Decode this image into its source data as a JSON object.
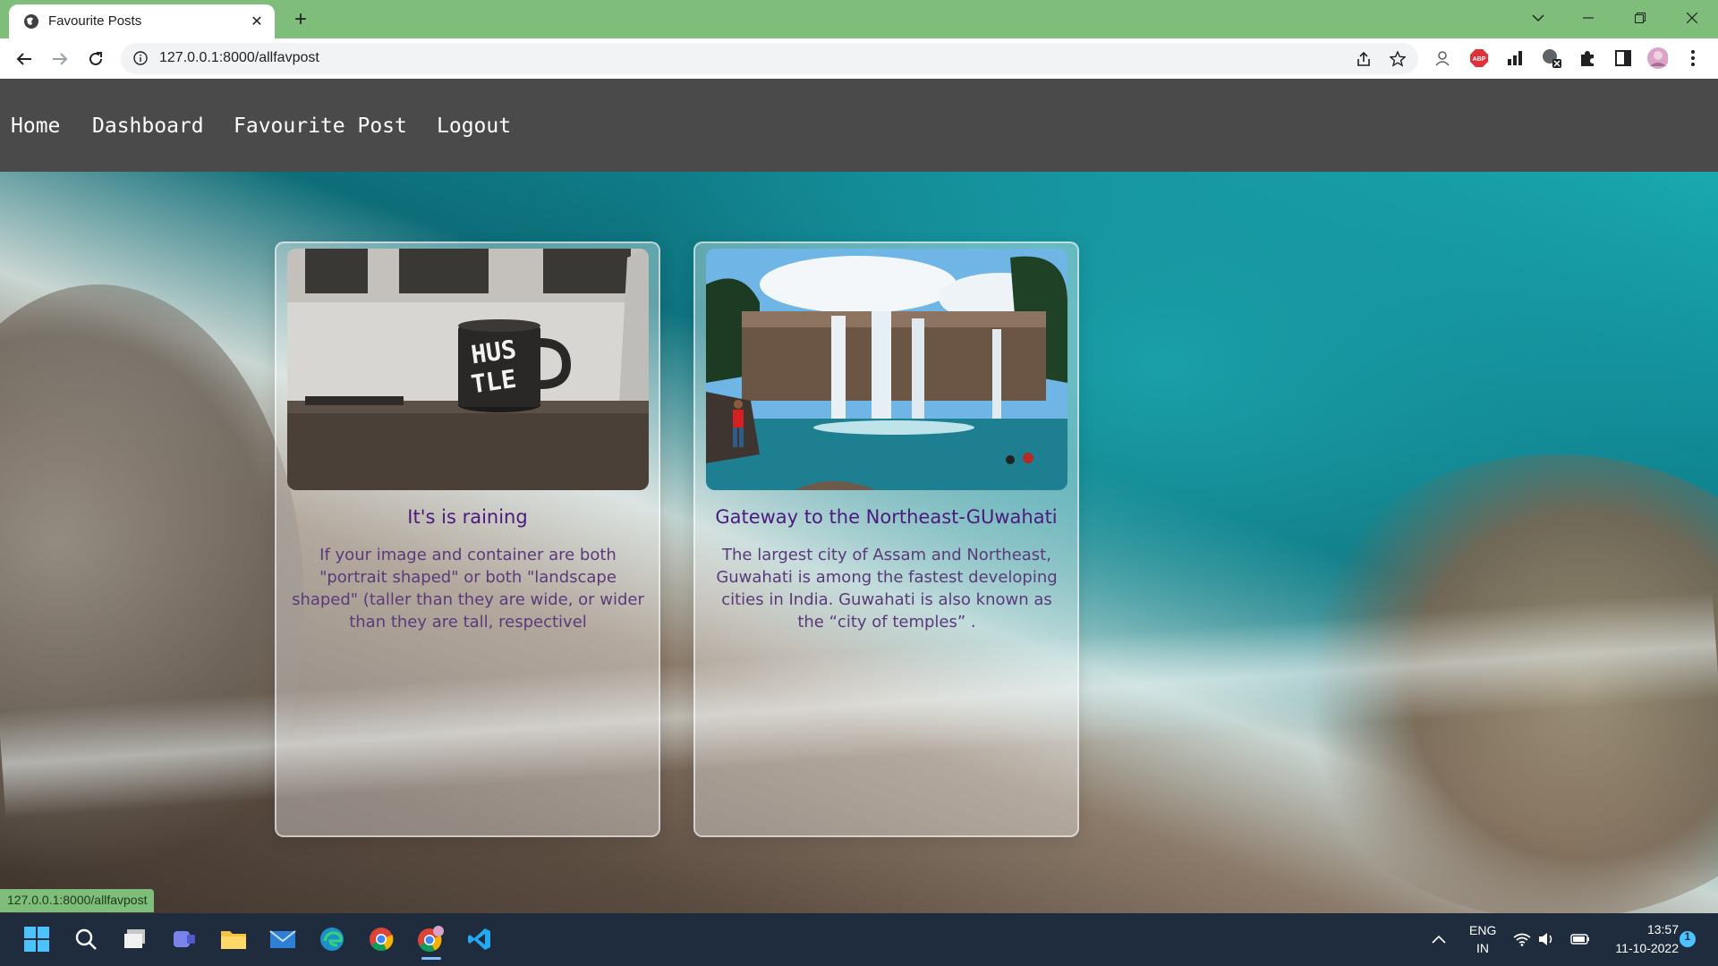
{
  "browser": {
    "tab_title": "Favourite Posts",
    "url": "127.0.0.1:8000/allfavpost",
    "status_bar_url": "127.0.0.1:8000/allfavpost",
    "accent_color": "#7fbd7a",
    "extensions": [
      "profile-icon",
      "adblock-icon",
      "chart-icon",
      "translate-icon",
      "puzzle-icon",
      "sidepanel-icon",
      "avatar-icon"
    ]
  },
  "navbar": {
    "items": [
      {
        "label": "Home"
      },
      {
        "label": "Dashboard"
      },
      {
        "label": "Favourite Post"
      },
      {
        "label": "Logout"
      }
    ],
    "background": "#4a4a4a"
  },
  "cards": [
    {
      "image": "mug-photo",
      "mug_text": "HUSTLE",
      "title": "It's is raining",
      "text": "If your image and container are both \"portrait shaped\" or both \"landscape shaped\" (taller than they are wide, or wider than they are tall, respectivel"
    },
    {
      "image": "waterfall-photo",
      "title": "Gateway to the Northeast-GUwahati",
      "text": "The largest city of Assam and Northeast, Guwahati is among the fastest developing cities in India. Guwahati is also known as the “city of temples” ."
    }
  ],
  "taskbar": {
    "apps": [
      "windows-start-icon",
      "search-icon",
      "task-view-icon",
      "teams-chat-icon",
      "file-explorer-icon",
      "mail-icon",
      "edge-icon",
      "chrome-icon",
      "chrome-profile-icon",
      "vscode-icon"
    ],
    "language": "ENG",
    "region": "IN",
    "time": "13:57",
    "date": "11-10-2022",
    "notification_count": "1"
  }
}
